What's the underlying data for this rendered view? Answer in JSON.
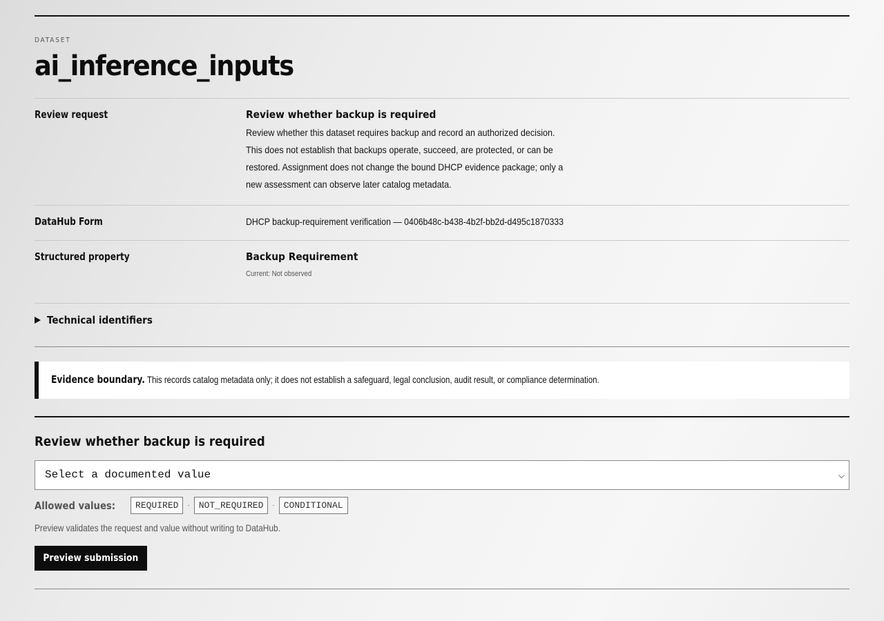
{
  "header": {
    "eyebrow": "DATASET",
    "title": "ai_inference_inputs"
  },
  "details": {
    "review_request": {
      "label": "Review request",
      "heading": "Review whether backup is required",
      "description": "Review whether this dataset requires backup and record an authorized decision. This does not establish that backups operate, succeed, are protected, or can be restored. Assignment does not change the bound DHCP evidence package; only a new assessment can observe later catalog metadata."
    },
    "datahub_form": {
      "label": "DataHub Form",
      "value": "DHCP backup-requirement verification — 0406b48c-b438-4b2f-bb2d-d495c1870333"
    },
    "structured_property": {
      "label": "Structured property",
      "name": "Backup Requirement",
      "current": "Current: Not observed"
    },
    "technical_identifiers": {
      "label": "Technical identifiers"
    }
  },
  "callout": {
    "strong": "Evidence boundary.",
    "text": " This records catalog metadata only; it does not establish a safeguard, legal conclusion, audit result, or compliance determination."
  },
  "form": {
    "title": "Review whether backup is required",
    "select_value": "Select a documented value",
    "allowed_label": "Allowed values:",
    "allowed_values": [
      "REQUIRED",
      "NOT_REQUIRED",
      "CONDITIONAL"
    ],
    "note": "Preview validates the request and value without writing to DataHub.",
    "button_label": "Preview submission"
  }
}
